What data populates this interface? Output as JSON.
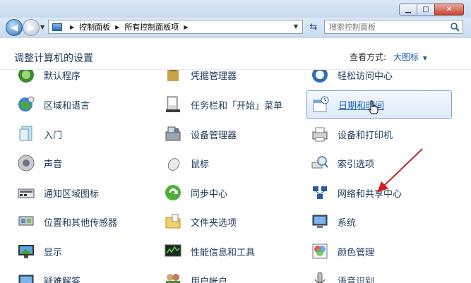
{
  "window": {
    "caption": {
      "minimize": "▁",
      "maximize": "□",
      "close": "✕"
    }
  },
  "nav": {
    "back_icon": "back-arrow-icon",
    "forward_icon": "forward-arrow-icon",
    "breadcrumbs": [
      "控制面板",
      "所有控制面板项"
    ],
    "search_placeholder": "搜索控制面板"
  },
  "content": {
    "heading": "调整计算机的设置",
    "view_by_label": "查看方式:",
    "view_by_value": "大图标"
  },
  "items": [
    {
      "label": "默认程序",
      "icon": "default-programs-icon"
    },
    {
      "label": "凭据管理器",
      "icon": "credential-manager-icon"
    },
    {
      "label": "轻松访问中心",
      "icon": "ease-of-access-icon"
    },
    {
      "label": "区域和语言",
      "icon": "region-language-icon"
    },
    {
      "label": "任务栏和「开始」菜单",
      "icon": "taskbar-start-menu-icon"
    },
    {
      "label": "日期和时间",
      "icon": "date-time-icon"
    },
    {
      "label": "入门",
      "icon": "getting-started-icon"
    },
    {
      "label": "设备管理器",
      "icon": "device-manager-icon"
    },
    {
      "label": "设备和打印机",
      "icon": "devices-printers-icon"
    },
    {
      "label": "声音",
      "icon": "sound-icon"
    },
    {
      "label": "鼠标",
      "icon": "mouse-icon"
    },
    {
      "label": "索引选项",
      "icon": "indexing-options-icon"
    },
    {
      "label": "通知区域图标",
      "icon": "notification-area-icon"
    },
    {
      "label": "同步中心",
      "icon": "sync-center-icon"
    },
    {
      "label": "网络和共享中心",
      "icon": "network-sharing-icon"
    },
    {
      "label": "位置和其他传感器",
      "icon": "location-sensors-icon"
    },
    {
      "label": "文件夹选项",
      "icon": "folder-options-icon"
    },
    {
      "label": "系统",
      "icon": "system-icon"
    },
    {
      "label": "显示",
      "icon": "display-icon"
    },
    {
      "label": "性能信息和工具",
      "icon": "performance-tools-icon"
    },
    {
      "label": "颜色管理",
      "icon": "color-management-icon"
    },
    {
      "label": "疑难解答",
      "icon": "troubleshooting-icon"
    },
    {
      "label": "用户帐户",
      "icon": "user-accounts-icon"
    },
    {
      "label": "语音识别",
      "icon": "speech-recognition-icon"
    }
  ],
  "colors": {
    "link_text": "#1e395b",
    "hover_text": "#1a5fb4",
    "annotation_arrow": "#d42020"
  }
}
